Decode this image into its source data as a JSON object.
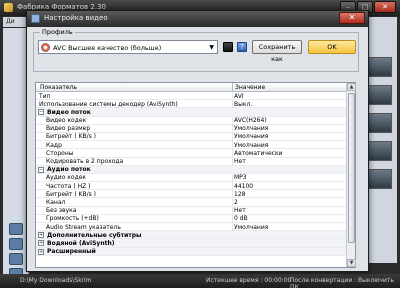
{
  "app": {
    "title": "Фабрика Форматов 2.30",
    "tab_label": "Ди",
    "min": "–",
    "max": "□",
    "close": "✕"
  },
  "statusbar": {
    "path": "D:\\My Downloads\\Skrim",
    "time_label": "Истекшее время : 00:00:00",
    "after_label": "После конвертации : Выключить ПК"
  },
  "dialog": {
    "title": "Настройка видео",
    "close": "✕",
    "profile_group_label": "Профиль",
    "profile_value": "AVC Высшее качество (больше)",
    "save_as_label": "Сохранить как",
    "ok_label": "OK",
    "grid": {
      "col_param": "Показатель",
      "col_value": "Значение",
      "rows": [
        {
          "type": "item",
          "key": "Тип",
          "value": "AVI"
        },
        {
          "type": "item",
          "key": "Использование системы декодер (AviSynth)",
          "value": "Выкл."
        },
        {
          "type": "cat",
          "key": "Видео поток",
          "toggle": "−"
        },
        {
          "type": "item",
          "key": "Видео кодек",
          "value": "AVC(H264)",
          "indent": true
        },
        {
          "type": "item",
          "key": "Видео размер",
          "value": "Умолчания",
          "indent": true
        },
        {
          "type": "item",
          "key": "Битрейт ( KB/s )",
          "value": "Умолчания",
          "indent": true
        },
        {
          "type": "item",
          "key": "Кадр",
          "value": "Умолчания",
          "indent": true
        },
        {
          "type": "item",
          "key": "Стороны",
          "value": "Автоматически",
          "indent": true
        },
        {
          "type": "item",
          "key": "Кодировать в 2 прохода",
          "value": "Нет",
          "indent": true
        },
        {
          "type": "cat",
          "key": "Аудио поток",
          "toggle": "−"
        },
        {
          "type": "item",
          "key": "Аудио кодек",
          "value": "MP3",
          "indent": true
        },
        {
          "type": "item",
          "key": "Частота ( HZ )",
          "value": "44100",
          "indent": true
        },
        {
          "type": "item",
          "key": "Битрейт ( KB/s )",
          "value": "128",
          "indent": true
        },
        {
          "type": "item",
          "key": "Канал",
          "value": "2",
          "indent": true
        },
        {
          "type": "item",
          "key": "Без звука",
          "value": "Нет",
          "indent": true
        },
        {
          "type": "item",
          "key": "Громкость (+dB)",
          "value": "0 dB",
          "indent": true
        },
        {
          "type": "item",
          "key": "Audio Stream указатель",
          "value": "Умолчания",
          "indent": true
        },
        {
          "type": "cat",
          "key": "Дополнительные субтитры",
          "toggle": "+"
        },
        {
          "type": "cat",
          "key": "Водяной (AviSynth)",
          "toggle": "+"
        },
        {
          "type": "cat",
          "key": "Расширенный",
          "toggle": "+"
        }
      ]
    }
  }
}
